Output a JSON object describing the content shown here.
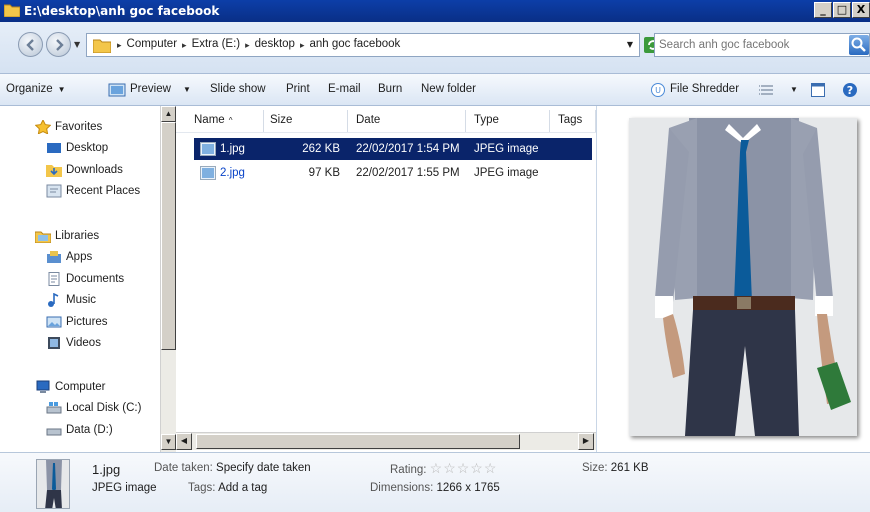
{
  "window": {
    "title": "E:\\desktop\\anh goc facebook",
    "buttons": {
      "minimize": "_",
      "maximize": "□",
      "close": "X"
    }
  },
  "address": {
    "crumbs": [
      "Computer",
      "Extra (E:)",
      "desktop",
      "anh goc facebook"
    ]
  },
  "search": {
    "placeholder": "Search anh goc facebook"
  },
  "toolbar": {
    "organize": "Organize",
    "preview": "Preview",
    "slideshow": "Slide show",
    "print": "Print",
    "email": "E-mail",
    "burn": "Burn",
    "new_folder": "New folder",
    "file_shredder": "File Shredder"
  },
  "sidebar": {
    "favorites": {
      "label": "Favorites",
      "items": [
        "Desktop",
        "Downloads",
        "Recent Places"
      ]
    },
    "libraries": {
      "label": "Libraries",
      "items": [
        "Apps",
        "Documents",
        "Music",
        "Pictures",
        "Videos"
      ]
    },
    "computer": {
      "label": "Computer",
      "items": [
        "Local Disk (C:)",
        "Data (D:)"
      ]
    }
  },
  "columns": [
    "Name",
    "Size",
    "Date",
    "Type",
    "Tags"
  ],
  "files": [
    {
      "name": "1.jpg",
      "size": "262 KB",
      "date": "22/02/2017 1:54 PM",
      "type": "JPEG image",
      "selected": true
    },
    {
      "name": "2.jpg",
      "size": "97 KB",
      "date": "22/02/2017 1:55 PM",
      "type": "JPEG image",
      "selected": false
    }
  ],
  "details": {
    "name": "1.jpg",
    "type": "JPEG image",
    "date_taken_label": "Date taken:",
    "date_taken_value": "Specify date taken",
    "tags_label": "Tags:",
    "tags_value": "Add a tag",
    "rating_label": "Rating:",
    "rating_value": 0,
    "dimensions_label": "Dimensions:",
    "dimensions_value": "1266 x 1765",
    "size_label": "Size:",
    "size_value": "261 KB"
  },
  "colors": {
    "title_bar": "#0c3ea8",
    "selection": "#0a246a",
    "link": "#0a44c8"
  }
}
